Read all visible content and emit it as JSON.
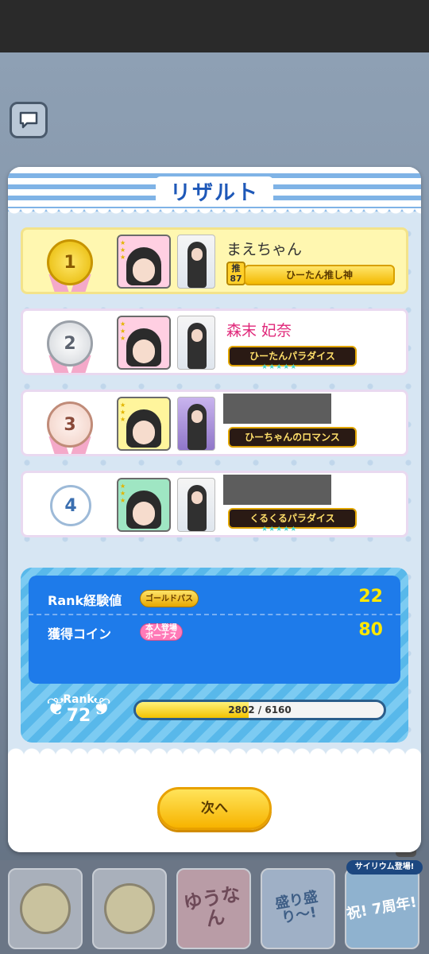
{
  "modal": {
    "title": "リザルト",
    "rows": [
      {
        "rank": "1",
        "avatar_label": "Hanon",
        "name": "まえちゃん",
        "oshi_badge": "推\n87",
        "title_plate": "ひーたん推し神"
      },
      {
        "rank": "2",
        "avatar_label": "Hanon",
        "name": "森末 妃奈",
        "title_plate": "ひーたんパラダイス"
      },
      {
        "rank": "3",
        "avatar_label": "Hinata",
        "name": "",
        "title_plate": "ひーちゃんのロマンス"
      },
      {
        "rank": "4",
        "avatar_label": "Saki",
        "name": "",
        "title_plate": "くるくるパラダイス"
      }
    ],
    "stats": {
      "exp_label": "Rank経験値",
      "exp_badge": "ゴールドパス",
      "exp_value": "22",
      "coin_label": "獲得コイン",
      "coin_badge": "本人登場\nボーナス",
      "coin_value": "80",
      "rank_label": "Rank",
      "rank_value": "72",
      "exp_progress_text": "2802 / 6160",
      "exp_progress_fraction": 0.455
    },
    "next_button": "次へ"
  },
  "bottom": {
    "tiles": [
      "ゆうなん",
      "盛り盛り〜!",
      "祝! 7周年!"
    ],
    "announce": "サイリウム登場!",
    "arrow": "›"
  },
  "colors": {
    "accent_blue": "#1e7bea",
    "title_blue": "#1e58b8",
    "gold": "#f7b400",
    "pink_name": "#e0287a"
  },
  "icons": {
    "chat": "chat-bubble-icon",
    "medals": [
      "gold-medal-icon",
      "silver-medal-icon",
      "bronze-medal-icon",
      "plain-medal-icon"
    ],
    "laurel": "laurel-icon"
  }
}
